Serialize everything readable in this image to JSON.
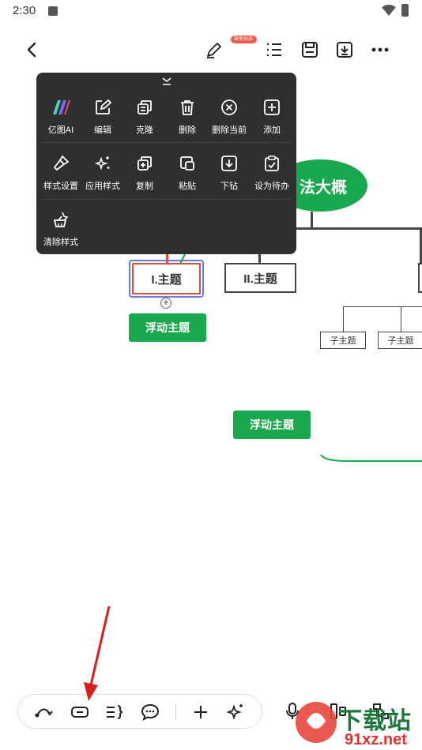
{
  "status": {
    "time": "2:30"
  },
  "toolbar": {
    "back": "back-icon",
    "badge": "限免30天",
    "icons": [
      "pen-icon",
      "outline-list-icon",
      "save-icon",
      "download-icon",
      "more-icon"
    ]
  },
  "menu": {
    "rows": [
      [
        {
          "label": "亿图AI",
          "icon": "ai-logo-icon"
        },
        {
          "label": "编辑",
          "icon": "edit-icon"
        },
        {
          "label": "克隆",
          "icon": "clone-icon"
        },
        {
          "label": "删除",
          "icon": "trash-icon"
        },
        {
          "label": "删除当前",
          "icon": "delete-current-icon"
        },
        {
          "label": "添加",
          "icon": "add-icon"
        }
      ],
      [
        {
          "label": "样式设置",
          "icon": "style-brush-icon"
        },
        {
          "label": "应用样式",
          "icon": "sparkle-icon"
        },
        {
          "label": "复制",
          "icon": "copy-icon"
        },
        {
          "label": "粘贴",
          "icon": "paste-icon"
        },
        {
          "label": "下钻",
          "icon": "drill-down-icon"
        },
        {
          "label": "设为待办",
          "icon": "todo-icon"
        }
      ],
      [
        {
          "label": "清除样式",
          "icon": "clear-style-icon"
        }
      ]
    ]
  },
  "mindmap": {
    "root": "法大概",
    "main_topics": [
      "I.主题",
      "II.主题"
    ],
    "sub_topics": [
      "子主题",
      "子主题"
    ],
    "floating": [
      "浮动主题",
      "浮动主题"
    ]
  },
  "bottom_bar": {
    "icons": [
      "relation-curve-icon",
      "topic-box-icon",
      "summary-icon",
      "comment-icon",
      "plus-icon",
      "magic-icon"
    ]
  },
  "watermark": {
    "line1": "下载站",
    "line2": "91xz.net"
  },
  "colors": {
    "accent_green": "#1aa84e",
    "menu_bg": "#2f2f2f",
    "selection_red": "#e24b3c",
    "selection_blue": "#6c7bd8"
  }
}
